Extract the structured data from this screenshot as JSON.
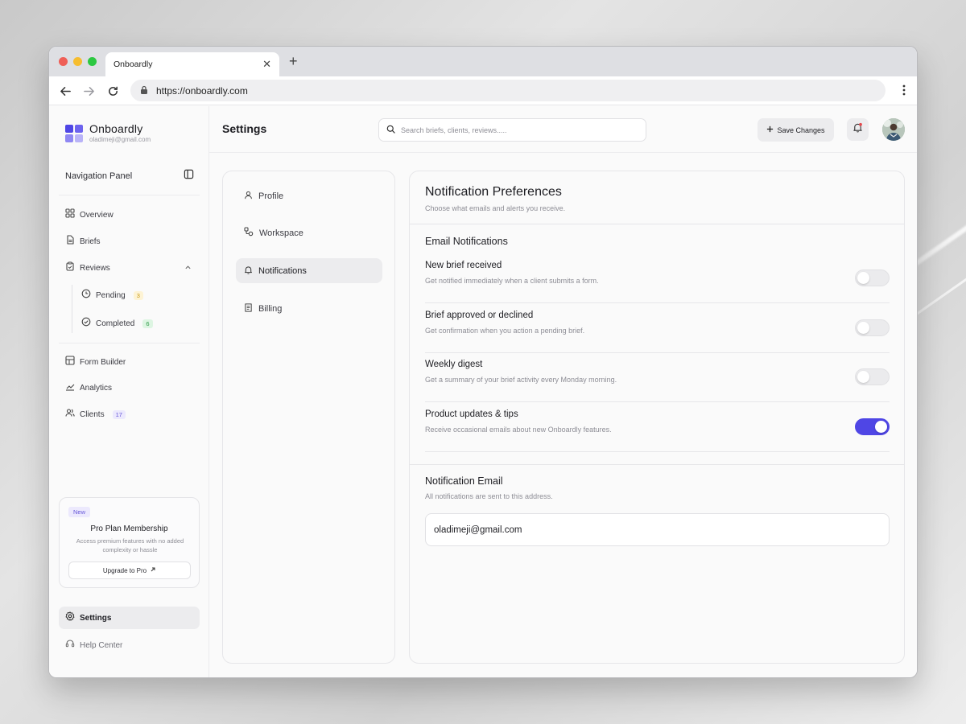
{
  "browser": {
    "tab_title": "Onboardly",
    "url": "https://onboardly.com"
  },
  "brand": {
    "name": "Onboardly",
    "email": "oladimeji@gmail.com",
    "logo_colors": [
      "#4f46e5",
      "#6d63ee",
      "#8f87f3",
      "#b9b3f8"
    ]
  },
  "sidebar": {
    "heading": "Navigation Panel",
    "items": [
      {
        "label": "Overview",
        "icon": "grid-icon"
      },
      {
        "label": "Briefs",
        "icon": "document-icon"
      },
      {
        "label": "Reviews",
        "icon": "clipboard-icon",
        "expanded": true
      },
      {
        "label": "Pending",
        "icon": "clock-icon",
        "badge": "3"
      },
      {
        "label": "Completed",
        "icon": "check-circle-icon",
        "badge": "6"
      },
      {
        "label": "Form Builder",
        "icon": "layout-icon"
      },
      {
        "label": "Analytics",
        "icon": "chart-icon"
      },
      {
        "label": "Clients",
        "icon": "users-icon",
        "badge": "17"
      }
    ],
    "promo": {
      "tag": "New",
      "title": "Pro Plan Membership",
      "description": "Access premium features with no added complexity or hassle",
      "button": "Upgrade to Pro"
    },
    "bottom": [
      {
        "label": "Settings",
        "icon": "gear-icon",
        "active": true
      },
      {
        "label": "Help Center",
        "icon": "headset-icon"
      }
    ]
  },
  "header": {
    "title": "Settings",
    "search_placeholder": "Search briefs, clients, reviews.....",
    "save_label": "Save Changes"
  },
  "settings_nav": [
    {
      "label": "Profile",
      "icon": "user-icon"
    },
    {
      "label": "Workspace",
      "icon": "workspace-icon"
    },
    {
      "label": "Notifications",
      "icon": "bell-icon",
      "active": true
    },
    {
      "label": "Billing",
      "icon": "receipt-icon"
    }
  ],
  "panel": {
    "title": "Notification Preferences",
    "subtitle": "Choose what emails and alerts you receive.",
    "email_section": "Email Notifications",
    "preferences": [
      {
        "label": "New brief received",
        "description": "Get notified immediately when a client submits a form.",
        "enabled": false
      },
      {
        "label": "Brief approved or declined",
        "description": "Get confirmation when you action a pending brief.",
        "enabled": false
      },
      {
        "label": "Weekly digest",
        "description": "Get a summary of your brief activity every Monday morning.",
        "enabled": false
      },
      {
        "label": "Product updates & tips",
        "description": "Receive occasional emails about new Onboardly features.",
        "enabled": true
      }
    ],
    "email_title": "Notification Email",
    "email_subtitle": "All notifications are sent to this address.",
    "email_value": "oladimeji@gmail.com"
  },
  "colors": {
    "accent": "#4f46e5",
    "toggle_off": "#ebebed"
  }
}
